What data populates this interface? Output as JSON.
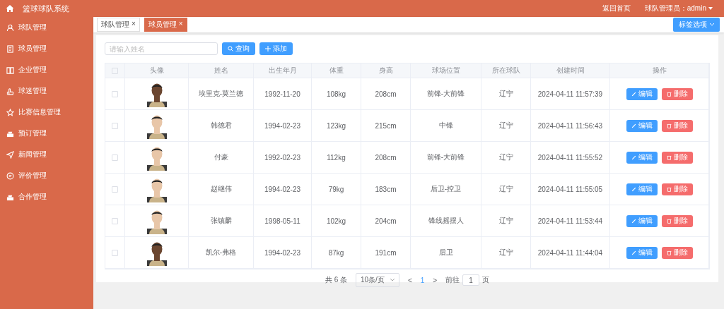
{
  "header": {
    "title": "篮球球队系统",
    "home_link": "返回首页",
    "user": "球队管理员：admin"
  },
  "sidebar": {
    "items": [
      {
        "label": "球队管理"
      },
      {
        "label": "球员管理"
      },
      {
        "label": "企业管理"
      },
      {
        "label": "球迷管理"
      },
      {
        "label": "比赛信息管理"
      },
      {
        "label": "预订管理"
      },
      {
        "label": "新闻管理"
      },
      {
        "label": "评价管理"
      },
      {
        "label": "合作管理"
      }
    ]
  },
  "tabs": [
    {
      "label": "球队管理",
      "close": "×",
      "selected": false
    },
    {
      "label": "球员管理",
      "close": "×",
      "selected": true
    }
  ],
  "tab_options": "标签选项",
  "search": {
    "placeholder": "请输入姓名",
    "search_button": "查询",
    "add_button": "添加"
  },
  "table": {
    "select_all": {
      "checked": false
    },
    "columns": [
      "头像",
      "姓名",
      "出生年月",
      "体重",
      "身高",
      "球场位置",
      "所在球队",
      "创建时间",
      "操作"
    ],
    "rows": [
      {
        "checked": false,
        "name": "埃里克-莫兰德",
        "birth": "1992-11-20",
        "weight": "108kg",
        "height": "208cm",
        "position": "前锋-大前锋",
        "team": "辽宁",
        "created": "2024-04-11 11:57:39",
        "edit": "编辑",
        "delete": "删除"
      },
      {
        "checked": false,
        "name": "韩德君",
        "birth": "1994-02-23",
        "weight": "123kg",
        "height": "215cm",
        "position": "中锋",
        "team": "辽宁",
        "created": "2024-04-11 11:56:43",
        "edit": "编辑",
        "delete": "删除"
      },
      {
        "checked": false,
        "name": "付豪",
        "birth": "1992-02-23",
        "weight": "112kg",
        "height": "208cm",
        "position": "前锋-大前锋",
        "team": "辽宁",
        "created": "2024-04-11 11:55:52",
        "edit": "编辑",
        "delete": "删除"
      },
      {
        "checked": false,
        "name": "赵继伟",
        "birth": "1994-02-23",
        "weight": "79kg",
        "height": "183cm",
        "position": "后卫-控卫",
        "team": "辽宁",
        "created": "2024-04-11 11:55:05",
        "edit": "编辑",
        "delete": "删除"
      },
      {
        "checked": false,
        "name": "张镇麟",
        "birth": "1998-05-11",
        "weight": "102kg",
        "height": "204cm",
        "position": "锋线摇摆人",
        "team": "辽宁",
        "created": "2024-04-11 11:53:44",
        "edit": "编辑",
        "delete": "删除"
      },
      {
        "checked": false,
        "name": "凯尔-弗格",
        "birth": "1994-02-23",
        "weight": "87kg",
        "height": "191cm",
        "position": "后卫",
        "team": "辽宁",
        "created": "2024-04-11 11:44:04",
        "edit": "编辑",
        "delete": "删除"
      }
    ]
  },
  "pagination": {
    "total": "共 6 条",
    "page_size": "10条/页",
    "prev": "<",
    "current": "1",
    "next": ">",
    "goto_label": "前往",
    "goto_value": "1",
    "page_suffix": "页"
  }
}
